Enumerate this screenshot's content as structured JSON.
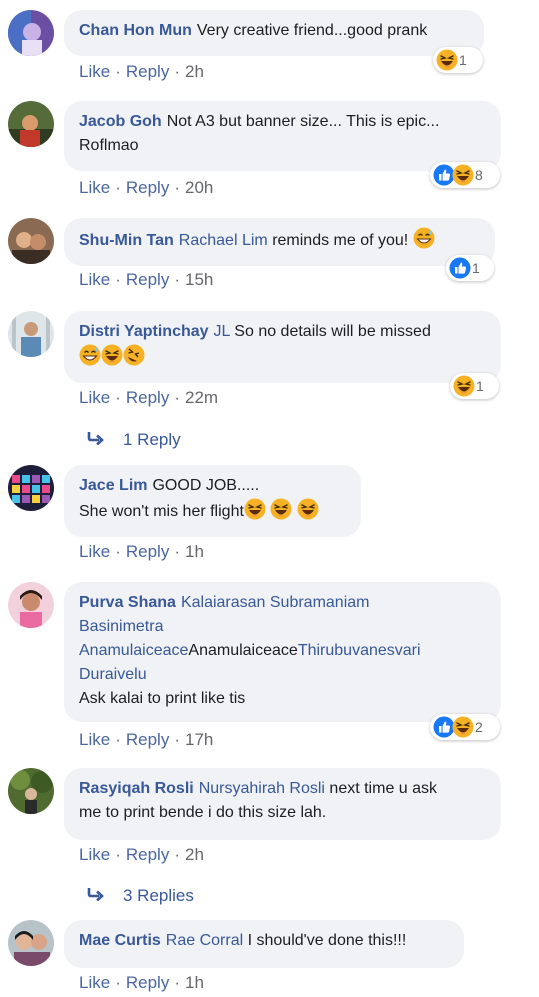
{
  "actions": {
    "like": "Like",
    "reply": "Reply",
    "dot": "·"
  },
  "comments": [
    {
      "author": "Chan Hon Mun",
      "text": "Very creative friend...good prank",
      "time": "2h",
      "reaction_count": "1"
    },
    {
      "author": "Jacob Goh",
      "text_line1": "Not A3 but banner size... This is epic...",
      "text_line2": "Roflmao",
      "time": "20h",
      "reaction_count": "8"
    },
    {
      "author": "Shu-Min Tan",
      "mention": "Rachael Lim",
      "text": "reminds me of you!",
      "time": "15h",
      "reaction_count": "1"
    },
    {
      "author": "Distri Yaptinchay",
      "mention": "JL",
      "text": "So no details will be missed",
      "time": "22m",
      "reaction_count": "1",
      "replies": "1 Reply"
    },
    {
      "author": "Jace Lim",
      "text_line1": "GOOD JOB.....",
      "text_line2": "She won't mis her flight",
      "time": "1h"
    },
    {
      "author": "Purva Shana",
      "mention1": "Kalaiarasan Subramaniam",
      "mention2": "Basinimetra",
      "mention3": "Anamulaiceace",
      "plain_mid": "Anamulaiceace",
      "mention4": "Thirubuvanesvari",
      "mention5": "Duraivelu",
      "text": "Ask kalai to print like tis",
      "time": "17h",
      "reaction_count": "2"
    },
    {
      "author": "Rasyiqah Rosli",
      "mention": "Nursyahirah Rosli",
      "text_line1": "next time u ask",
      "text_line2": "me to print bende i do this size lah.",
      "time": "2h",
      "replies": "3 Replies"
    },
    {
      "author": "Mae Curtis",
      "mention": "Rae Corral",
      "text": "I should've done this!!!",
      "time": "1h"
    }
  ],
  "icons": {
    "reply_arrow": "reply-arrow-icon",
    "like": "like-reaction-icon",
    "haha": "haha-reaction-icon"
  },
  "colors": {
    "link": "#385898",
    "bubble": "#f0f2f5",
    "like_blue": "#1877f2",
    "emoji_yellow": "#f7b125"
  }
}
